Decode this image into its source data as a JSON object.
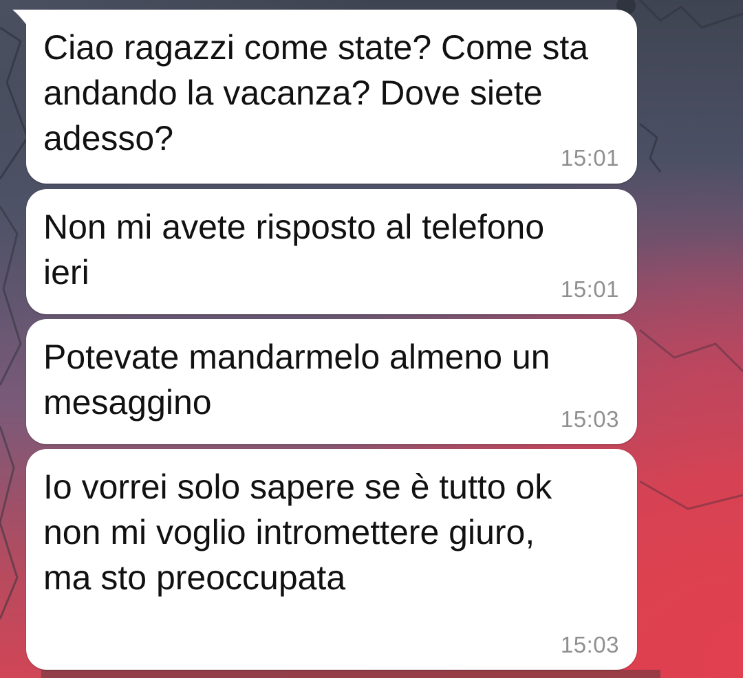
{
  "colors": {
    "bubble_bg": "#ffffff",
    "text": "#111111",
    "timestamp": "#8f8f8f",
    "wallpaper_accent": "#d04657"
  },
  "messages": [
    {
      "text": "Ciao ragazzi come state? Come sta andando la vacanza? Dove siete adesso?",
      "time": "15:01"
    },
    {
      "text": "Non mi avete risposto al telefono ieri",
      "time": "15:01"
    },
    {
      "text": "Potevate mandarmelo almeno un mesaggino",
      "time": "15:03"
    },
    {
      "text": "Io vorrei solo sapere se è tutto ok non mi voglio intromettere giuro,  ma sto preoccupata",
      "time": "15:03"
    }
  ]
}
